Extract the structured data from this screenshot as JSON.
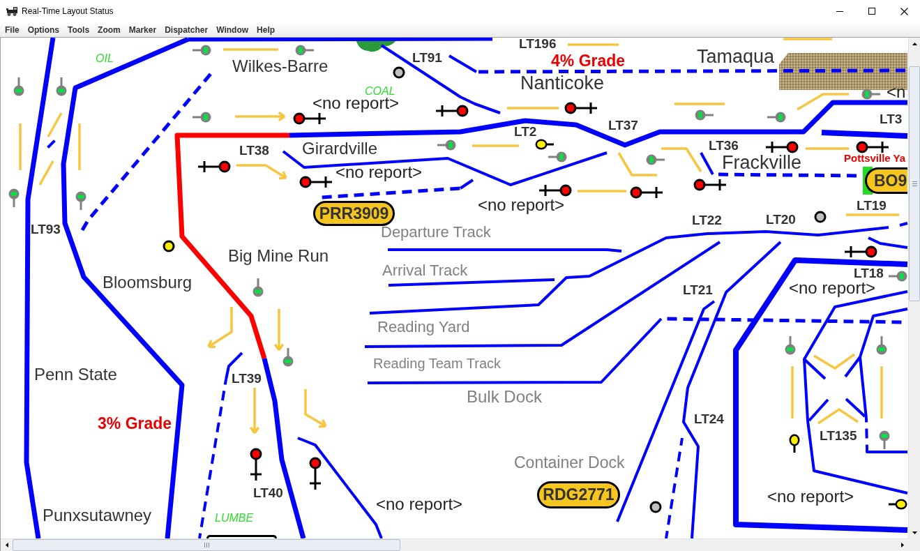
{
  "window": {
    "title": "Real-Time Layout Status"
  },
  "menu": [
    "File",
    "Options",
    "Tools",
    "Zoom",
    "Marker",
    "Dispatcher",
    "Window",
    "Help"
  ],
  "panel": {
    "labels": [
      {
        "kind": "industry",
        "text": "OIL"
      },
      {
        "kind": "place",
        "text": "Wilkes-Barre"
      },
      {
        "kind": "block",
        "text": "LT91"
      },
      {
        "kind": "industry",
        "text": "COAL"
      },
      {
        "kind": "report",
        "text": "<no report>"
      },
      {
        "kind": "block",
        "text": "LT196"
      },
      {
        "kind": "grade",
        "text": "4% Grade"
      },
      {
        "kind": "place",
        "text": "Nanticoke"
      },
      {
        "kind": "place",
        "text": "Tamaqua"
      },
      {
        "kind": "report",
        "text": "<n"
      },
      {
        "kind": "block",
        "text": "LT2"
      },
      {
        "kind": "block",
        "text": "LT37"
      },
      {
        "kind": "block",
        "text": "LT3"
      },
      {
        "kind": "block",
        "text": "LT38"
      },
      {
        "kind": "place",
        "text": "Girardville"
      },
      {
        "kind": "block",
        "text": "LT36"
      },
      {
        "kind": "place",
        "text": "Frackville"
      },
      {
        "kind": "yard",
        "text": "Pottsville Ya"
      },
      {
        "kind": "report",
        "text": "<no report>"
      },
      {
        "kind": "report",
        "text": "<no report>"
      },
      {
        "kind": "block",
        "text": "LT19"
      },
      {
        "kind": "block",
        "text": "LT93"
      },
      {
        "kind": "block",
        "text": "LT22"
      },
      {
        "kind": "block",
        "text": "LT20"
      },
      {
        "kind": "track",
        "text": "Departure Track"
      },
      {
        "kind": "track",
        "text": "Arrival Track"
      },
      {
        "kind": "place",
        "text": "Big Mine Run"
      },
      {
        "kind": "place",
        "text": "Bloomsburg"
      },
      {
        "kind": "block",
        "text": "LT18"
      },
      {
        "kind": "block",
        "text": "LT21"
      },
      {
        "kind": "report",
        "text": "<no report>"
      },
      {
        "kind": "track",
        "text": "Reading Yard"
      },
      {
        "kind": "track",
        "text": "Reading Team Track"
      },
      {
        "kind": "place",
        "text": "Penn State"
      },
      {
        "kind": "block",
        "text": "LT39"
      },
      {
        "kind": "track",
        "text": "Bulk Dock"
      },
      {
        "kind": "grade",
        "text": "3% Grade"
      },
      {
        "kind": "block",
        "text": "LT24"
      },
      {
        "kind": "block",
        "text": "LT135"
      },
      {
        "kind": "track",
        "text": "Container Dock"
      },
      {
        "kind": "block",
        "text": "LT40"
      },
      {
        "kind": "report",
        "text": "<no report>"
      },
      {
        "kind": "report",
        "text": "<no report>"
      },
      {
        "kind": "place",
        "text": "Punxsutawney"
      },
      {
        "kind": "industry",
        "text": "LUMBE"
      }
    ],
    "trains": [
      {
        "label": "PRR3909"
      },
      {
        "label": "BO9"
      },
      {
        "label": "RDG2771"
      }
    ],
    "signals": [
      {
        "kind": "searchlight",
        "color": "#00e640"
      },
      {
        "kind": "searchlight",
        "color": "#00e640"
      },
      {
        "kind": "searchlight",
        "color": "#00e640"
      },
      {
        "kind": "searchlight",
        "color": "#00e640"
      },
      {
        "kind": "searchlight",
        "color": "#00e640"
      },
      {
        "kind": "searchlight",
        "color": "#00e640"
      },
      {
        "kind": "searchlight",
        "color": "#00e640"
      },
      {
        "kind": "searchlight",
        "color": "#00e640"
      },
      {
        "kind": "searchlight",
        "color": "#00e640"
      },
      {
        "kind": "searchlight",
        "color": "#00e640"
      },
      {
        "kind": "searchlight",
        "color": "#00e640"
      },
      {
        "kind": "searchlight",
        "color": "#00e640"
      },
      {
        "kind": "searchlight",
        "color": "#00e640"
      },
      {
        "kind": "searchlight",
        "color": "#00e640"
      },
      {
        "kind": "searchlight",
        "color": "#00e640"
      },
      {
        "kind": "searchlight",
        "color": "#00e640"
      },
      {
        "kind": "searchlight",
        "color": "#00e640"
      },
      {
        "kind": "searchlight",
        "color": "#00e640"
      },
      {
        "kind": "searchlight",
        "color": "#00e640"
      },
      {
        "kind": "target",
        "color": "#ff0000"
      },
      {
        "kind": "target",
        "color": "#ff0000"
      },
      {
        "kind": "target",
        "color": "#ff0000"
      },
      {
        "kind": "target",
        "color": "#ff0000"
      },
      {
        "kind": "target",
        "color": "#ff0000"
      },
      {
        "kind": "target",
        "color": "#ff0000"
      },
      {
        "kind": "target",
        "color": "#ff0000"
      },
      {
        "kind": "target",
        "color": "#ff0000"
      },
      {
        "kind": "target",
        "color": "#ff0000"
      },
      {
        "kind": "target",
        "color": "#ff0000"
      },
      {
        "kind": "target",
        "color": "#ff0000"
      },
      {
        "kind": "target",
        "color": "#ff0000"
      },
      {
        "kind": "target",
        "color": "#ff0000"
      },
      {
        "kind": "plain",
        "color": "#ffee00"
      },
      {
        "kind": "plain",
        "color": "#ffee00"
      },
      {
        "kind": "plain",
        "color": "#ffee00"
      }
    ],
    "sensors": [
      {
        "color": "#c0c0c0"
      },
      {
        "color": "#ffee00"
      },
      {
        "color": "#c0c0c0"
      },
      {
        "color": "#c0c0c0"
      }
    ],
    "tracks": [
      {
        "kind": "solid",
        "occupied": false
      },
      {
        "kind": "solid",
        "occupied": false
      },
      {
        "kind": "solid",
        "occupied": false
      },
      {
        "kind": "dashed",
        "occupied": false
      },
      {
        "kind": "dashed",
        "occupied": false
      },
      {
        "kind": "solid",
        "occupied": true
      },
      {
        "kind": "solid",
        "occupied": false
      },
      {
        "kind": "solid",
        "occupied": false
      },
      {
        "kind": "solid",
        "occupied": false
      },
      {
        "kind": "solid",
        "occupied": false
      },
      {
        "kind": "solid",
        "occupied": false
      },
      {
        "kind": "solid",
        "occupied": false
      },
      {
        "kind": "dashed",
        "occupied": false
      },
      {
        "kind": "dashed",
        "occupied": false
      },
      {
        "kind": "solid",
        "occupied": false
      },
      {
        "kind": "solid",
        "occupied": false
      },
      {
        "kind": "dashed",
        "occupied": false
      },
      {
        "kind": "solid",
        "occupied": false
      },
      {
        "kind": "solid",
        "occupied": false
      },
      {
        "kind": "solid",
        "occupied": false
      },
      {
        "kind": "dashed",
        "occupied": false
      },
      {
        "kind": "solid",
        "occupied": false
      },
      {
        "kind": "solid",
        "occupied": false
      },
      {
        "kind": "dashed",
        "occupied": false
      },
      {
        "kind": "solid",
        "occupied": false
      },
      {
        "kind": "solid",
        "occupied": false
      },
      {
        "kind": "dashed",
        "occupied": false
      },
      {
        "kind": "solid",
        "occupied": false
      },
      {
        "kind": "solid",
        "occupied": false
      },
      {
        "kind": "solid",
        "occupied": false
      },
      {
        "kind": "solid",
        "occupied": false
      },
      {
        "kind": "dashed",
        "occupied": false
      },
      {
        "kind": "solid",
        "occupied": false
      },
      {
        "kind": "solid",
        "occupied": false
      },
      {
        "kind": "solid",
        "occupied": false
      },
      {
        "kind": "solid",
        "occupied": false
      },
      {
        "kind": "solid",
        "occupied": false
      },
      {
        "kind": "solid",
        "occupied": false
      },
      {
        "kind": "solid",
        "occupied": false
      },
      {
        "kind": "dashed",
        "occupied": false
      }
    ]
  }
}
